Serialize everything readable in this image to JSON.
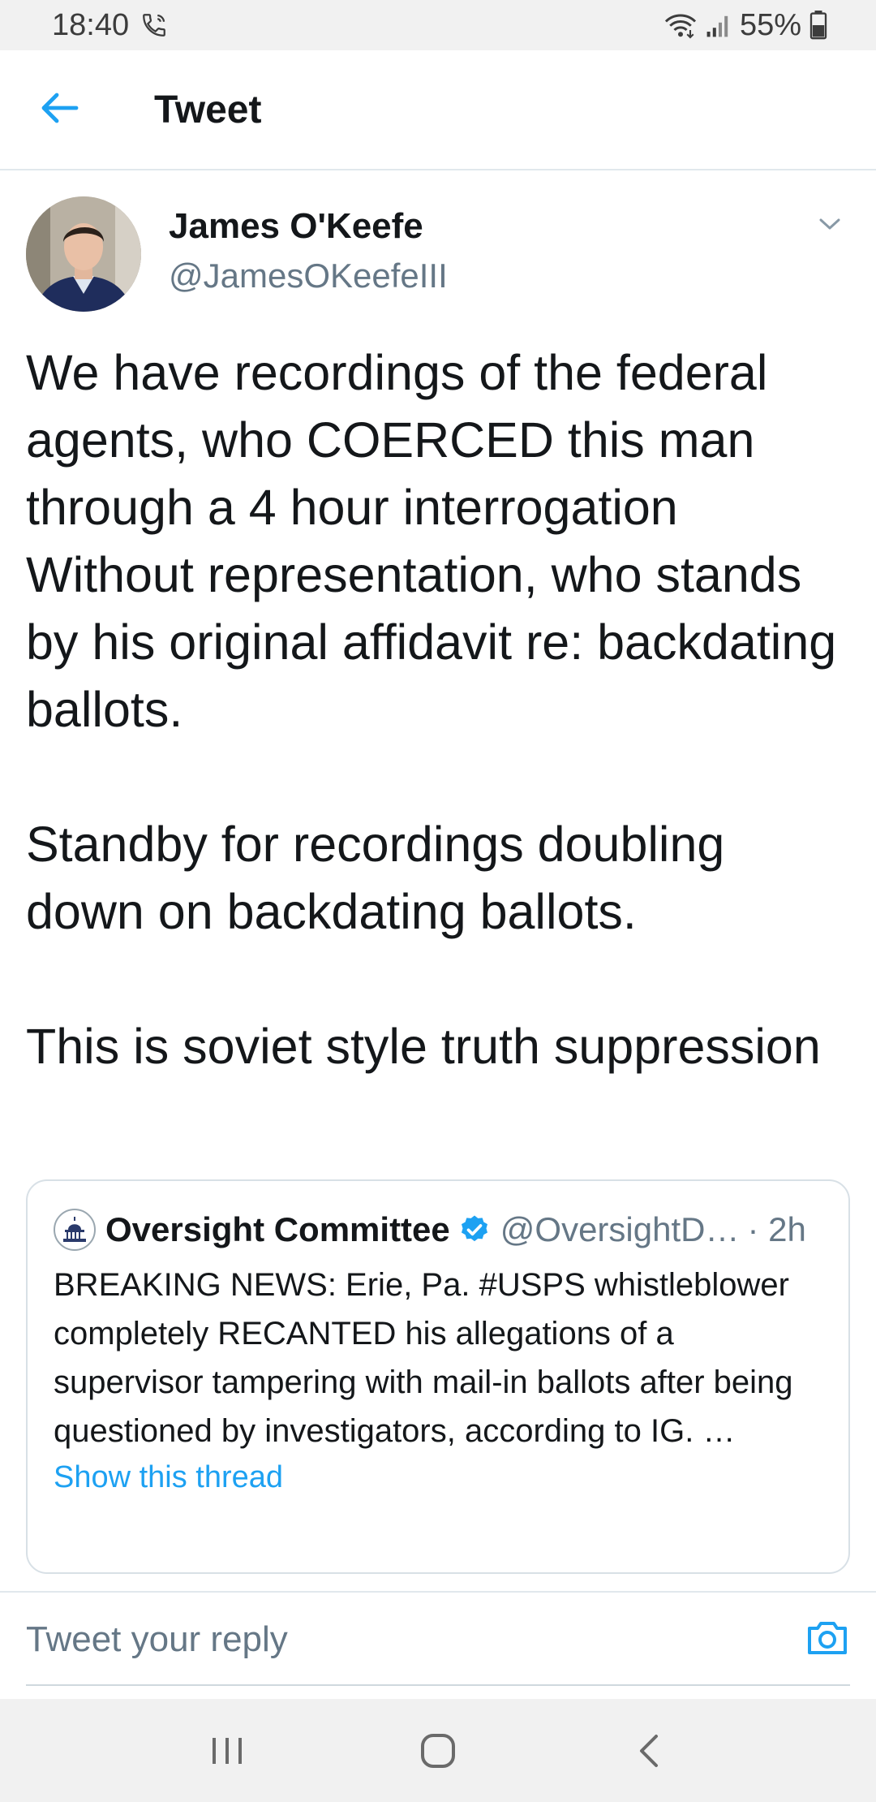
{
  "status_bar": {
    "time": "18:40",
    "battery": "55%",
    "icons": [
      "call-icon",
      "wifi-icon",
      "signal-icon",
      "battery-icon"
    ]
  },
  "app_bar": {
    "title": "Tweet",
    "back_icon": "back-arrow-icon"
  },
  "tweet": {
    "author_name": "James O'Keefe",
    "author_handle": "@JamesOKeefeIII",
    "text": "We have recordings of the federal agents, who COERCED this man through a 4 hour interrogation Without representation, who stands by his original affidavit re: backdating ballots.\n\nStandby for recordings doubling down on backdating ballots.\n\nThis is soviet style truth suppression"
  },
  "quoted_tweet": {
    "name": "Oversight Committee",
    "handle": "@OversightD…",
    "time": "· 2h",
    "text": "BREAKING NEWS: Erie, Pa. #USPS whistleblower completely RECANTED his allegations of a supervisor tampering with mail-in ballots after being questioned by investigators, according to IG. …",
    "show_thread": "Show this thread"
  },
  "reply": {
    "placeholder": "Tweet your reply",
    "camera_icon": "camera-icon"
  },
  "nav_bar": {
    "icons": [
      "recents-icon",
      "home-icon",
      "back-icon"
    ]
  },
  "colors": {
    "accent": "#1da1f2",
    "text": "#14171a",
    "secondary_text": "#657786",
    "border": "#e1e8ed"
  }
}
